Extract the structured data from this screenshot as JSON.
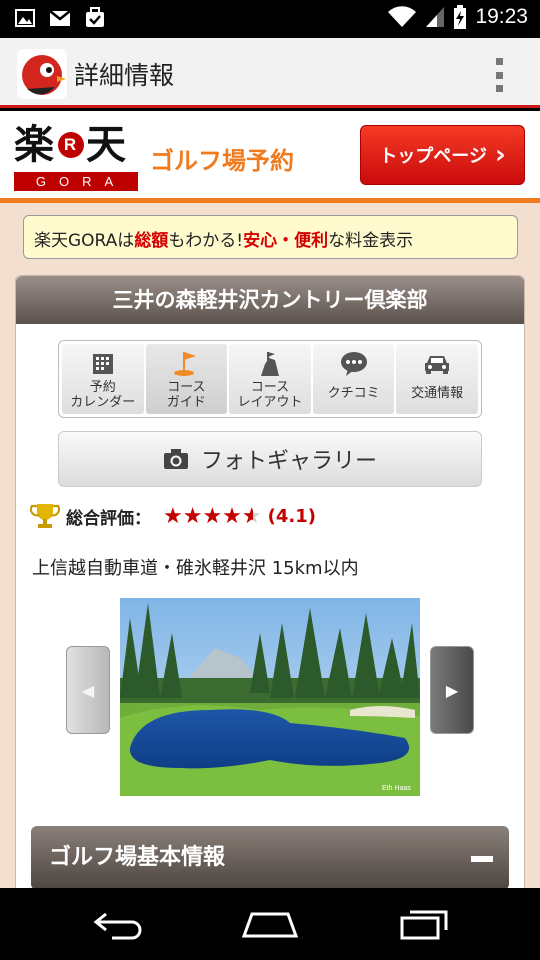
{
  "status_bar": {
    "time": "19:23"
  },
  "app_bar": {
    "title": "詳細情報"
  },
  "brand": {
    "logo_text": "楽天",
    "logo_letter": "R",
    "logo_sub": "GORA",
    "service": "ゴルフ場予約",
    "top_page_button": "トップページ"
  },
  "notice": {
    "p1": "楽天GORAは",
    "p2": "総額",
    "p3": "もわかる!",
    "p4": "安心・便利",
    "p5": "な料金表示"
  },
  "course": {
    "name": "三井の森軽井沢カントリー倶楽部",
    "tabs": [
      {
        "label": "予約\nカレンダー",
        "icon": "calendar-icon"
      },
      {
        "label": "コース\nガイド",
        "icon": "flag-icon"
      },
      {
        "label": "コース\nレイアウト",
        "icon": "hole-layout-icon"
      },
      {
        "label": "クチコミ",
        "icon": "speech-bubble-icon"
      },
      {
        "label": "交通情報",
        "icon": "car-icon"
      }
    ],
    "photo_gallery_button": "フォトギャラリー",
    "rating": {
      "label": "総合評価：",
      "score_text": "(4.1)",
      "value": 4.1,
      "max": 5
    },
    "access": "上信越自動車道・碓氷軽井沢 15km以内",
    "photo_credit": "Eth Haas",
    "basic_info_header": "ゴルフ場基本情報"
  },
  "colors": {
    "rakuten_red": "#bf0000",
    "accent_orange": "#ef7b1e",
    "star_red": "#c40000"
  }
}
